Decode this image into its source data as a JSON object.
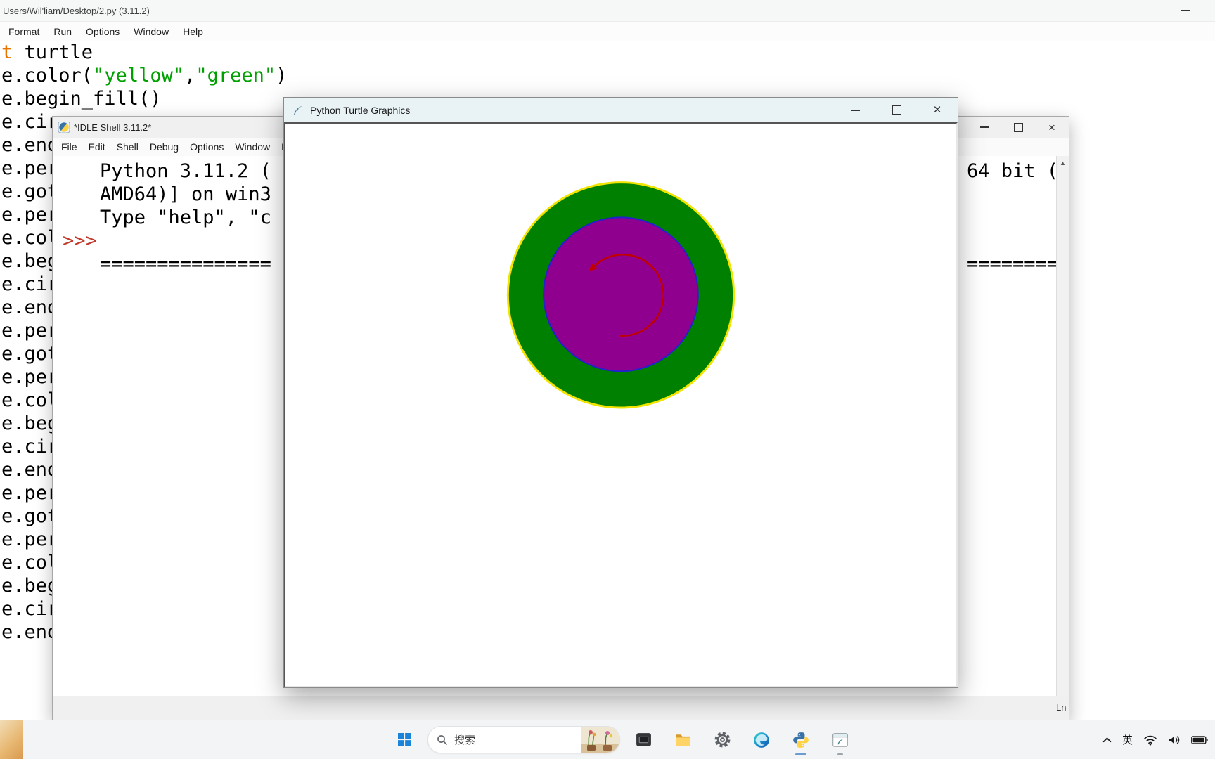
{
  "editor": {
    "title": "Users/Wil'liam/Desktop/2.py (3.11.2)",
    "menus": [
      "Format",
      "Run",
      "Options",
      "Window",
      "Help"
    ],
    "syntax_colors": {
      "keyword": "#e87400",
      "string": "#00a000",
      "plain": "#000000"
    },
    "code_lines": [
      [
        [
          "k",
          "t"
        ],
        [
          "p",
          " turtle"
        ]
      ],
      [
        [
          "p",
          "e.color("
        ],
        [
          "s",
          "\"yellow\""
        ],
        [
          "p",
          ","
        ],
        [
          "s",
          "\"green\""
        ],
        [
          "p",
          ")"
        ]
      ],
      [
        [
          "p",
          "e.begin_fill()"
        ]
      ],
      [
        [
          "p",
          "e.cir"
        ]
      ],
      [
        [
          "p",
          "e.end"
        ]
      ],
      [
        [
          "p",
          "e.per"
        ]
      ],
      [
        [
          "p",
          "e.got"
        ]
      ],
      [
        [
          "p",
          "e.per"
        ]
      ],
      [
        [
          "p",
          "e.col"
        ]
      ],
      [
        [
          "p",
          "e.beg"
        ]
      ],
      [
        [
          "p",
          "e.cir"
        ]
      ],
      [
        [
          "p",
          "e.end"
        ]
      ],
      [
        [
          "p",
          "e.per"
        ]
      ],
      [
        [
          "p",
          "e.got"
        ]
      ],
      [
        [
          "p",
          "e.per"
        ]
      ],
      [
        [
          "p",
          "e.col"
        ]
      ],
      [
        [
          "p",
          "e.beg"
        ]
      ],
      [
        [
          "p",
          "e.cir"
        ]
      ],
      [
        [
          "p",
          "e.end"
        ]
      ],
      [
        [
          "p",
          "e.per"
        ]
      ],
      [
        [
          "p",
          "e.got"
        ]
      ],
      [
        [
          "p",
          "e.per"
        ]
      ],
      [
        [
          "p",
          "e.col"
        ]
      ],
      [
        [
          "p",
          "e.beg"
        ]
      ],
      [
        [
          "p",
          "e.cir"
        ]
      ],
      [
        [
          "p",
          "e.end"
        ]
      ]
    ]
  },
  "shell": {
    "title": "*IDLE Shell 3.11.2*",
    "menus": [
      "File",
      "Edit",
      "Shell",
      "Debug",
      "Options",
      "Window",
      "Help"
    ],
    "prompt": ">>>",
    "prompt_color": "#c0392b",
    "lines": [
      {
        "left": "Python 3.11.2 (",
        "right": "64 bit ("
      },
      {
        "left": "AMD64)] on win3",
        "right": ""
      },
      {
        "left": "Type \"help\", \"c",
        "right": ""
      },
      {
        "left": "",
        "right": "",
        "prompt": true
      },
      {
        "left": "===============",
        "right": "========="
      }
    ],
    "scroll_up_glyph": "▲",
    "status_right": "Ln",
    "close_glyph": "×"
  },
  "turtle_win": {
    "title": "Python Turtle Graphics",
    "close_glyph": "×",
    "drawing": {
      "outer_fill": "#008000",
      "outer_stroke": "#f2e400",
      "outer_r": 161,
      "inner_fill": "#90008e",
      "inner_stroke": "#2222cc",
      "inner_r": 110,
      "arc_color": "#c00000"
    }
  },
  "taskbar": {
    "search_placeholder": "搜索",
    "ime": "英"
  }
}
